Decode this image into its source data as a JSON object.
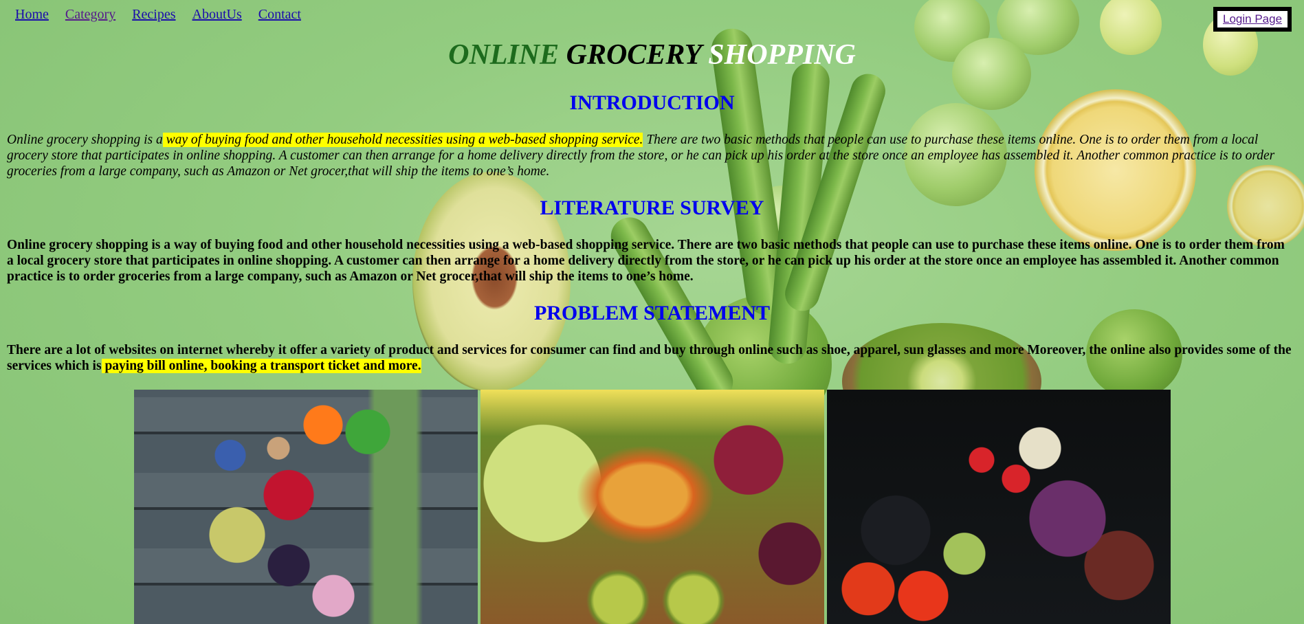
{
  "nav": {
    "items": [
      {
        "label": "Home",
        "visited": false
      },
      {
        "label": "Category",
        "visited": true
      },
      {
        "label": "Recipes",
        "visited": false
      },
      {
        "label": "AboutUs",
        "visited": false
      },
      {
        "label": "Contact",
        "visited": false
      }
    ],
    "login_label": "Login Page"
  },
  "title": {
    "part1": "ONLINE",
    "part2": "GROCERY",
    "part3": "SHOPPING",
    "colors": {
      "part1": "#1d6b1d",
      "part2": "#000000",
      "part3": "#ffffff"
    }
  },
  "introduction": {
    "heading": "INTRODUCTION",
    "text_before": "Online grocery shopping is a",
    "text_highlight": " way of buying food and other household necessities using a web-based shopping service.",
    "text_after": " There are two basic methods that people can use to purchase these items online. One is to order them from a local grocery store that participates in online shopping. A customer can then arrange for a home delivery directly from the store, or he can pick up his order at the store once an employee has assembled it. Another common practice is to order groceries from a large company, such as Amazon or Net grocer,that will ship the items to one’s home."
  },
  "literature_survey": {
    "heading": "LITERATURE SURVEY",
    "text": "Online grocery shopping is a way of buying food and other household necessities using a web-based shopping service. There are two basic methods that people can use to purchase these items online. One is to order them from a local grocery store that participates in online shopping. A customer can then arrange for a home delivery directly from the store, or he can pick up his order at the store once an employee has assembled it. Another common practice is to order groceries from a large company, such as Amazon or Net grocer,that will ship the items to one’s home."
  },
  "problem_statement": {
    "heading": "PROBLEM STATEMENT",
    "text_before": "There are a lot of websites on internet whereby it offer a variety of product and services for consumer can find and buy through online such as shoe, apparel, sun glasses and more Moreover, the online also provides some of the services which is",
    "text_highlight": " paying bill online, booking a transport ticket and more."
  },
  "colors": {
    "heading": "#0000ee",
    "highlight": "#ffff00",
    "link": "#1a0dab",
    "visited_link": "#551a8b",
    "background": "#8fc97c"
  },
  "images": [
    "vegetables-photo",
    "fruits-photo",
    "root-vegetables-photo"
  ]
}
